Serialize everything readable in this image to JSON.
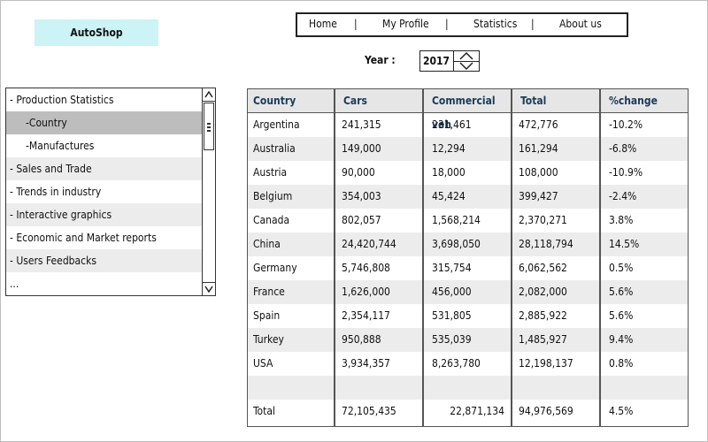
{
  "app": {
    "logo": "AutoShop"
  },
  "nav": {
    "items": [
      "Home",
      "My Profile",
      "Statistics",
      "About us"
    ],
    "separator": "|"
  },
  "year": {
    "label": "Year :",
    "value": "2017"
  },
  "tree": {
    "items": [
      {
        "label": "- Production Statistics",
        "level": 0,
        "selected": false
      },
      {
        "label": "-Country",
        "level": 1,
        "selected": true
      },
      {
        "label": "-Manufactures",
        "level": 1,
        "selected": false
      },
      {
        "label": "- Sales and Trade",
        "level": 0,
        "selected": false
      },
      {
        "label": "- Trends in industry",
        "level": 0,
        "selected": false
      },
      {
        "label": "- Interactive graphics",
        "level": 0,
        "selected": false
      },
      {
        "label": "- Economic and Market reports",
        "level": 0,
        "selected": false
      },
      {
        "label": "- Users Feedbacks",
        "level": 0,
        "selected": false
      },
      {
        "label": "...",
        "level": 0,
        "selected": false
      }
    ]
  },
  "table": {
    "columns": [
      "Country",
      "Cars",
      "Commercial veh",
      "Total",
      "%change"
    ],
    "rows": [
      [
        "Argentina",
        "241,315",
        "231,461",
        "472,776",
        "-10.2%"
      ],
      [
        "Australia",
        "149,000",
        "12,294",
        "161,294",
        " -6.8%"
      ],
      [
        "Austria",
        "90,000",
        "18,000",
        "108,000",
        "-10.9%"
      ],
      [
        "Belgium",
        "354,003",
        "45,424",
        "399,427",
        "-2.4%"
      ],
      [
        "Canada",
        "802,057",
        "1,568,214",
        "2,370,271",
        "3.8%"
      ],
      [
        "China",
        "24,420,744",
        "3,698,050",
        "28,118,794",
        "14.5%"
      ],
      [
        "Germany",
        "5,746,808",
        "315,754",
        "6,062,562",
        "0.5%"
      ],
      [
        "France",
        "1,626,000",
        "456,000",
        "2,082,000",
        "5.6%"
      ],
      [
        "Spain",
        "2,354,117",
        "531,805",
        "2,885,922",
        "5.6%"
      ],
      [
        "Turkey",
        "950,888",
        "535,039",
        "1,485,927",
        "9.4%"
      ],
      [
        "USA",
        "3,934,357",
        "8,263,780",
        "12,198,137",
        "0.8%"
      ],
      [
        "",
        "",
        "",
        "",
        ""
      ],
      [
        "Total",
        "72,105,435",
        "22,871,134",
        "94,976,569",
        "4.5%"
      ]
    ]
  }
}
